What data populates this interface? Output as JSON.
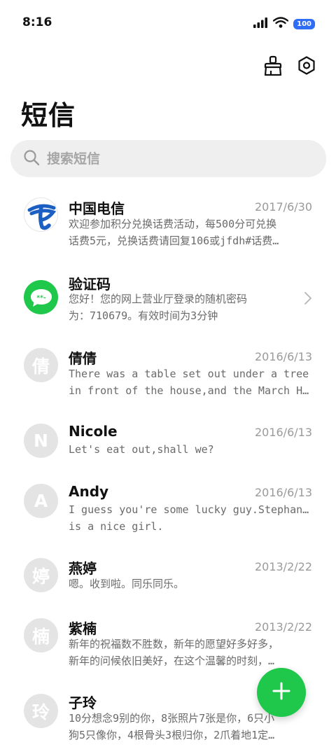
{
  "status_bar": {
    "time": "8:16",
    "battery": "100"
  },
  "header": {
    "title": "短信"
  },
  "search": {
    "placeholder": "搜索短信"
  },
  "conversations": [
    {
      "name": "中国电信",
      "date": "2017/6/30",
      "preview_line1": "欢迎参加积分兑换话费活动，每500分可兑换",
      "preview_line2": "话费5元，兑换话费请回复106或jfdh#话费…",
      "avatar": "china-telecom-logo"
    },
    {
      "name": "验证码",
      "date": "",
      "preview_line1": "您好！您的网上营业厅登录的随机密码",
      "preview_line2": "为：710679。有效时间为3分钟",
      "avatar": "sms-code-icon",
      "avatar_text": "**-"
    },
    {
      "name": "倩倩",
      "date": "2016/6/13",
      "preview_line1": "There was a table set out under a tree",
      "preview_line2": "in front of the house,and the March H…",
      "avatar_letter": "倩"
    },
    {
      "name": "Nicole",
      "date": "2016/6/13",
      "preview_line1": "Let's eat out,shall we?",
      "preview_line2": "",
      "avatar_letter": "N"
    },
    {
      "name": "Andy",
      "date": "2016/6/13",
      "preview_line1": "I guess you're some lucky guy.Stephanie",
      "preview_line2": "is a nice girl.",
      "avatar_letter": "A"
    },
    {
      "name": "燕婷",
      "date": "2013/2/22",
      "preview_line1": "嗯。收到啦。同乐同乐。",
      "preview_line2": "",
      "avatar_letter": "婷"
    },
    {
      "name": "紫楠",
      "date": "2013/2/22",
      "preview_line1": "新年的祝福数不胜数，新年的愿望好多好多，",
      "preview_line2": "新年的问候依旧美好，在这个温馨的时刻，…",
      "avatar_letter": "楠"
    },
    {
      "name": "子玲",
      "date": "",
      "preview_line1": "10分想念9别的你，8张照片7张是你，6只小",
      "preview_line2": "狗5只像你，4根骨头3根归你，2爪着地1定…",
      "avatar_letter": "玲"
    }
  ],
  "colors": {
    "accent_green": "#1fc84b",
    "telecom_blue": "#1c5fc2",
    "avatar_gray": "#e4e4e4",
    "search_bg": "#efefef"
  }
}
